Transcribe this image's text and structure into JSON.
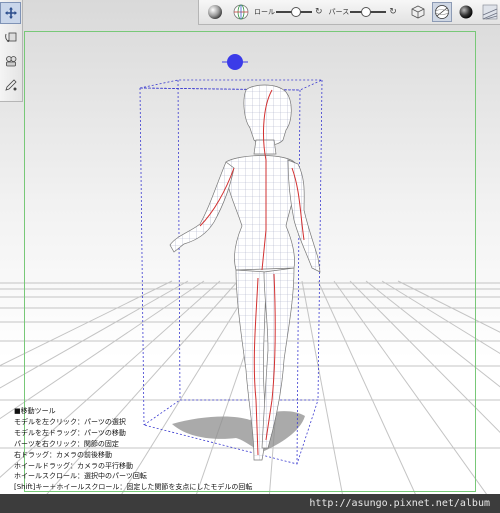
{
  "toolbar": {
    "roll_label": "ロール",
    "perspective_label": "パース",
    "roll_value": 0.55,
    "perspective_value": 0.45
  },
  "left_tools": [
    "move-tool-icon",
    "camera-rotate-icon",
    "pose-icon",
    "pen-icon"
  ],
  "help": {
    "heading": "■移動ツール",
    "lines": [
      "モデルを左クリック：パーツの選択",
      "モデルを左ドラッグ：パーツの移動",
      "パーツを右クリック：関節の固定",
      "右ドラッグ：カメラの前後移動",
      "ホイールドラッグ：カメラの平行移動",
      "ホイールスクロール：選択中のパーツ回転",
      "[Shift]キー＋ホイールスクロール：固定した関節を支点にしたモデルの回転"
    ]
  },
  "watermark": "http://asungo.pixnet.net/album",
  "colors": {
    "selection_handle": "#3b3be8",
    "bounding_box": "#3b3bd0",
    "bone_line": "#d23030",
    "grid_line": "#c4c4c4",
    "frame_guide": "#78c878"
  }
}
